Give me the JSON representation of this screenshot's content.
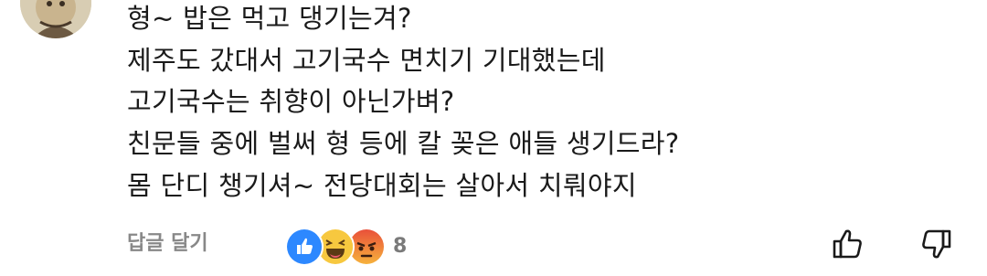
{
  "comment": {
    "lines": [
      "형~ 밥은 먹고 댕기는겨?",
      "제주도 갔대서 고기국수 면치기 기대했는데",
      "고기국수는 취향이 아닌가벼?",
      "친문들 중에 벌써 형 등에 칼 꽂은 애들 생기드라?",
      "몸 단디 챙기셔~ 전당대회는 살아서 치뤄야지"
    ]
  },
  "actions": {
    "reply_label": "답글 달기",
    "reaction_count": "8",
    "reactions": [
      "like-icon",
      "haha-icon",
      "angry-icon"
    ]
  },
  "colors": {
    "text": "#1a1a1a",
    "muted": "#888888",
    "like_blue": "#2d88ff",
    "haha_yellow": "#f7c83f",
    "angry_red": "#e9503a"
  }
}
